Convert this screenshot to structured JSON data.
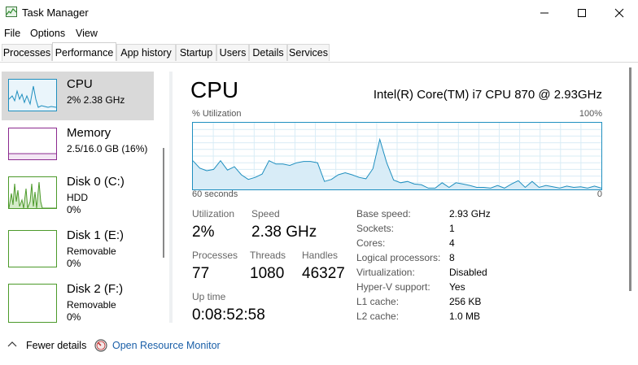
{
  "window": {
    "title": "Task Manager",
    "icon": "task-manager-icon"
  },
  "menu": [
    "File",
    "Options",
    "View"
  ],
  "tabs": [
    "Processes",
    "Performance",
    "App history",
    "Startup",
    "Users",
    "Details",
    "Services"
  ],
  "active_tab": "Performance",
  "resources": [
    {
      "name": "CPU",
      "sub1": "2%  2.38 GHz",
      "sub2": "",
      "color": "#1f8fbf"
    },
    {
      "name": "Memory",
      "sub1": "2.5/16.0 GB (16%)",
      "sub2": "",
      "color": "#8b2a8f"
    },
    {
      "name": "Disk 0 (C:)",
      "sub1": "HDD",
      "sub2": "0%",
      "color": "#4c9a2a"
    },
    {
      "name": "Disk 1 (E:)",
      "sub1": "Removable",
      "sub2": "0%",
      "color": "#4c9a2a"
    },
    {
      "name": "Disk 2 (F:)",
      "sub1": "Removable",
      "sub2": "0%",
      "color": "#4c9a2a"
    }
  ],
  "cpu": {
    "title": "CPU",
    "model": "Intel(R) Core(TM) i7 CPU 870 @ 2.93GHz",
    "graph_label": "% Utilization",
    "graph_max": "100%",
    "graph_time": "60 seconds",
    "graph_min": "0",
    "utilization_samples": [
      43,
      32,
      28,
      30,
      43,
      29,
      34,
      22,
      15,
      18,
      23,
      43,
      38,
      38,
      36,
      40,
      42,
      42,
      40,
      12,
      15,
      22,
      25,
      22,
      18,
      16,
      31,
      75,
      40,
      14,
      10,
      12,
      8,
      7,
      2,
      2,
      10,
      3,
      10,
      8,
      6,
      3,
      3,
      2,
      6,
      2,
      8,
      13,
      3,
      12,
      3,
      6,
      4,
      2,
      5,
      3,
      4,
      2,
      5,
      2
    ],
    "stats": {
      "utilization_label": "Utilization",
      "utilization": "2%",
      "speed_label": "Speed",
      "speed": "2.38 GHz",
      "processes_label": "Processes",
      "processes": "77",
      "threads_label": "Threads",
      "threads": "1080",
      "handles_label": "Handles",
      "handles": "46327",
      "uptime_label": "Up time",
      "uptime": "0:08:52:58"
    },
    "properties": [
      {
        "label": "Base speed:",
        "value": "2.93 GHz"
      },
      {
        "label": "Sockets:",
        "value": "1"
      },
      {
        "label": "Cores:",
        "value": "4"
      },
      {
        "label": "Logical processors:",
        "value": "8"
      },
      {
        "label": "Virtualization:",
        "value": "Disabled"
      },
      {
        "label": "Hyper-V support:",
        "value": "Yes"
      },
      {
        "label": "L1 cache:",
        "value": "256 KB"
      },
      {
        "label": "L2 cache:",
        "value": "1.0 MB"
      }
    ]
  },
  "footer": {
    "fewer_details": "Fewer details",
    "open_resource_monitor": "Open Resource Monitor"
  },
  "colors": {
    "accent": "#1f8fbf",
    "graph_fill": "#d8ecf7",
    "link": "#1a5fa8"
  }
}
